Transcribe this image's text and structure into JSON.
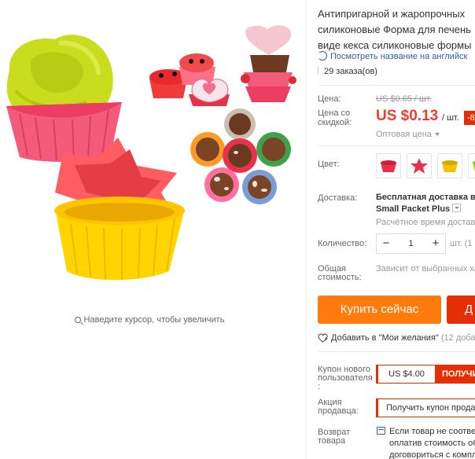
{
  "product": {
    "title_lines": [
      "Антипригарной и жаропрочных",
      "силиконовые Форма для печень",
      "виде кекса силиконовые формы"
    ],
    "translate_link": "Посмотреть название на английск",
    "orders": "29 заказа(ов)"
  },
  "gallery": {
    "zoom_hint": "Наведите курсор, чтобы увеличить"
  },
  "price": {
    "label": "Цена:",
    "old": "US $0.65 / шт.",
    "discount_label_1": "Цена со",
    "discount_label_2": "скидкой:",
    "current": "US $0.13",
    "unit": "/ шт.",
    "discount_badge": "-8",
    "wholesale": "Оптовая цена"
  },
  "color": {
    "label": "Цвет:",
    "swatches": [
      {
        "icon": "red-cupcake-mold-icon",
        "color": "#e8324a"
      },
      {
        "icon": "red-star-mold-icon",
        "color": "#e8324a"
      },
      {
        "icon": "yellow-cupcake-mold-icon",
        "color": "#f2c300"
      },
      {
        "icon": "green-cupcake-mold-icon",
        "color": "#a8d22a"
      }
    ]
  },
  "shipping": {
    "label": "Доставка:",
    "main": "Бесплатная доставка в",
    "method": "Small Packet Plus",
    "time": "Расчётное время доставк"
  },
  "quantity": {
    "label": "Количество:",
    "minus": "−",
    "value": "1",
    "plus": "+",
    "unit": "шт. (1"
  },
  "total": {
    "label_1": "Общая",
    "label_2": "стоимость:",
    "value": "Зависит от выбранных хар"
  },
  "actions": {
    "buy_now": "Купить сейчас",
    "add_to_cart": "Д",
    "wishlist": "Добавить в \"Мои желания\"",
    "wishlist_count": "(12 добав"
  },
  "coupons": {
    "new_user_label_1": "Купон нового",
    "new_user_label_2": "пользователя",
    "new_user_label_3": ":",
    "new_user_amount": "US $4.00",
    "new_user_get": "ПОЛУЧИ",
    "seller_label_1": "Акция",
    "seller_label_2": "продавца:",
    "seller_get": "Получить купон прода"
  },
  "returns": {
    "label_1": "Возврат",
    "label_2": "товара",
    "line_1": "Если товар не соответ",
    "line_2": "оплатив стоимость об",
    "line_3": "договориться с компл"
  }
}
